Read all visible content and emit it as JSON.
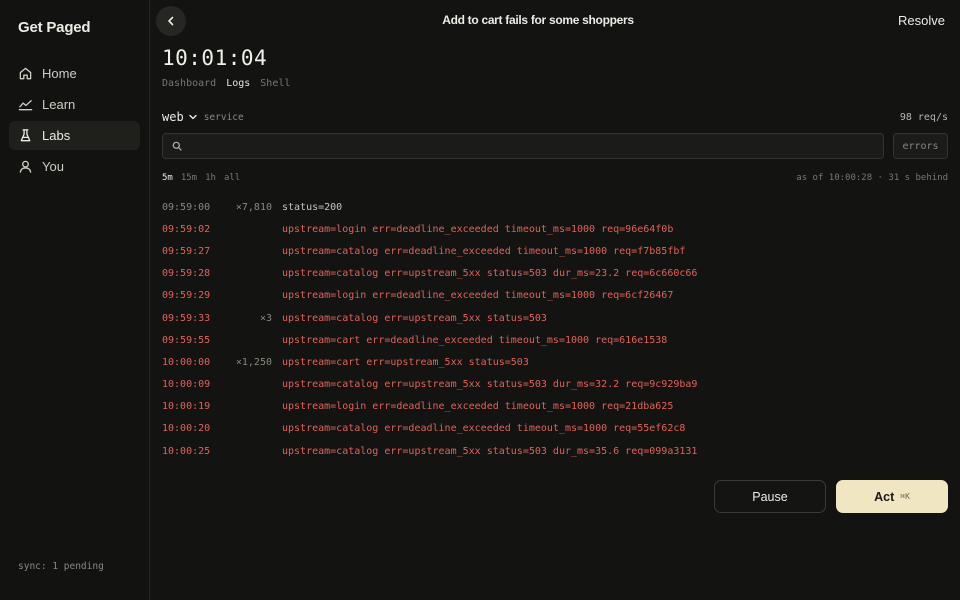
{
  "app": {
    "brand": "Get Paged"
  },
  "sidebar": {
    "items": [
      {
        "label": "Home",
        "icon": "home-icon"
      },
      {
        "label": "Learn",
        "icon": "chart-line-icon"
      },
      {
        "label": "Labs",
        "icon": "flask-icon",
        "active": true
      },
      {
        "label": "You",
        "icon": "user-icon"
      }
    ],
    "sync_status": "sync: 1 pending"
  },
  "header": {
    "title": "Add to cart fails for some shoppers",
    "resolve_label": "Resolve",
    "back_icon": "chevron-left-icon"
  },
  "clock": "10:01:04",
  "tabs": [
    {
      "label": "Dashboard"
    },
    {
      "label": "Logs",
      "active": true
    },
    {
      "label": "Shell"
    }
  ],
  "service": {
    "name": "web",
    "label": "service",
    "rate": "98 req/s"
  },
  "search": {
    "value": "",
    "placeholder": ""
  },
  "filter_chip": "errors",
  "ranges": [
    {
      "label": "5m",
      "active": true
    },
    {
      "label": "15m"
    },
    {
      "label": "1h"
    },
    {
      "label": "all"
    }
  ],
  "as_of": "as of 10:00:28 · 31 s behind",
  "logs": [
    {
      "time": "09:59:00",
      "count": "×7,810",
      "msg": "status=200",
      "level": "info"
    },
    {
      "time": "09:59:02",
      "count": "",
      "msg": "upstream=login err=deadline_exceeded timeout_ms=1000 req=96e64f0b",
      "level": "error"
    },
    {
      "time": "09:59:27",
      "count": "",
      "msg": "upstream=catalog err=deadline_exceeded timeout_ms=1000 req=f7b85fbf",
      "level": "error"
    },
    {
      "time": "09:59:28",
      "count": "",
      "msg": "upstream=catalog err=upstream_5xx status=503 dur_ms=23.2 req=6c660c66",
      "level": "error"
    },
    {
      "time": "09:59:29",
      "count": "",
      "msg": "upstream=login err=deadline_exceeded timeout_ms=1000 req=6cf26467",
      "level": "error"
    },
    {
      "time": "09:59:33",
      "count": "×3",
      "msg": "upstream=catalog err=upstream_5xx status=503",
      "level": "error"
    },
    {
      "time": "09:59:55",
      "count": "",
      "msg": "upstream=cart err=deadline_exceeded timeout_ms=1000 req=616e1538",
      "level": "error"
    },
    {
      "time": "10:00:00",
      "count": "×1,250",
      "msg": "upstream=cart err=upstream_5xx status=503",
      "level": "error"
    },
    {
      "time": "10:00:09",
      "count": "",
      "msg": "upstream=catalog err=upstream_5xx status=503 dur_ms=32.2 req=9c929ba9",
      "level": "error"
    },
    {
      "time": "10:00:19",
      "count": "",
      "msg": "upstream=login err=deadline_exceeded timeout_ms=1000 req=21dba625",
      "level": "error"
    },
    {
      "time": "10:00:20",
      "count": "",
      "msg": "upstream=catalog err=deadline_exceeded timeout_ms=1000 req=55ef62c8",
      "level": "error"
    },
    {
      "time": "10:00:25",
      "count": "",
      "msg": "upstream=catalog err=upstream_5xx status=503 dur_ms=35.6 req=099a3131",
      "level": "error"
    }
  ],
  "actions": {
    "pause_label": "Pause",
    "act_label": "Act",
    "act_shortcut": "⌘K"
  },
  "colors": {
    "background": "#131312",
    "accent_button": "#f1e6c2",
    "error_text": "#e0625b"
  }
}
